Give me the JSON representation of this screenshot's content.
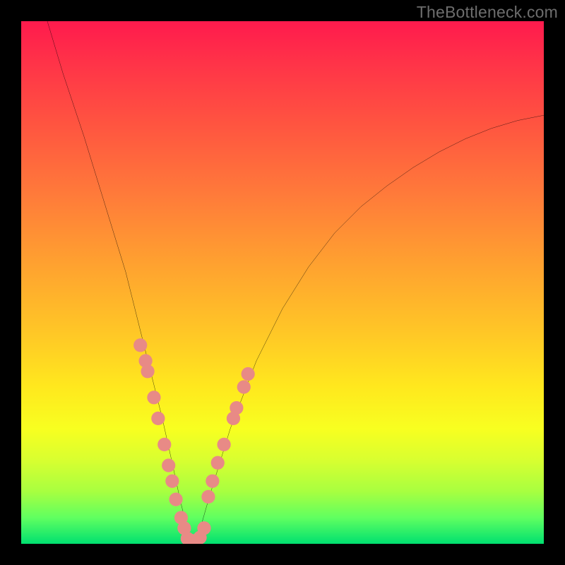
{
  "watermark": "TheBottleneck.com",
  "chart_data": {
    "type": "line",
    "title": "",
    "xlabel": "",
    "ylabel": "",
    "xlim": [
      0,
      100
    ],
    "ylim": [
      0,
      100
    ],
    "curve": {
      "name": "bottleneck-curve",
      "x": [
        5,
        8,
        12,
        16,
        20,
        23,
        25,
        27,
        29,
        30.5,
        32,
        33,
        34,
        36,
        40,
        45,
        50,
        55,
        60,
        65,
        70,
        75,
        80,
        85,
        90,
        95,
        100
      ],
      "y": [
        100,
        90,
        78,
        65,
        52,
        40,
        32,
        24,
        15,
        8,
        2,
        0.5,
        2,
        9,
        22,
        35,
        45,
        53,
        59.5,
        64.5,
        68.5,
        72,
        75,
        77.5,
        79.5,
        81,
        82
      ]
    },
    "dots_left": {
      "name": "left-branch-markers",
      "x": [
        22.8,
        23.8,
        24.2,
        25.4,
        26.2,
        27.4,
        28.2,
        28.9,
        29.6,
        30.6,
        31.2
      ],
      "y": [
        38,
        35,
        33,
        28,
        24,
        19,
        15,
        12,
        8.5,
        5,
        3
      ]
    },
    "dots_right": {
      "name": "right-branch-markers",
      "x": [
        35.8,
        36.6,
        37.6,
        38.8,
        40.6,
        41.2,
        42.6,
        43.4
      ],
      "y": [
        9,
        12,
        15.5,
        19,
        24,
        26,
        30,
        32.5
      ]
    },
    "dots_bottom": {
      "name": "trough-markers",
      "x": [
        31.8,
        32.6,
        33.4,
        34.2,
        35.0
      ],
      "y": [
        1.0,
        0.6,
        0.6,
        1.2,
        3.0
      ]
    },
    "dot_radius": 1.3,
    "gradient_stops": [
      {
        "pos": 0,
        "color": "#ff1a4d"
      },
      {
        "pos": 33,
        "color": "#ff7a3a"
      },
      {
        "pos": 70,
        "color": "#ffe81e"
      },
      {
        "pos": 100,
        "color": "#00e070"
      }
    ]
  }
}
